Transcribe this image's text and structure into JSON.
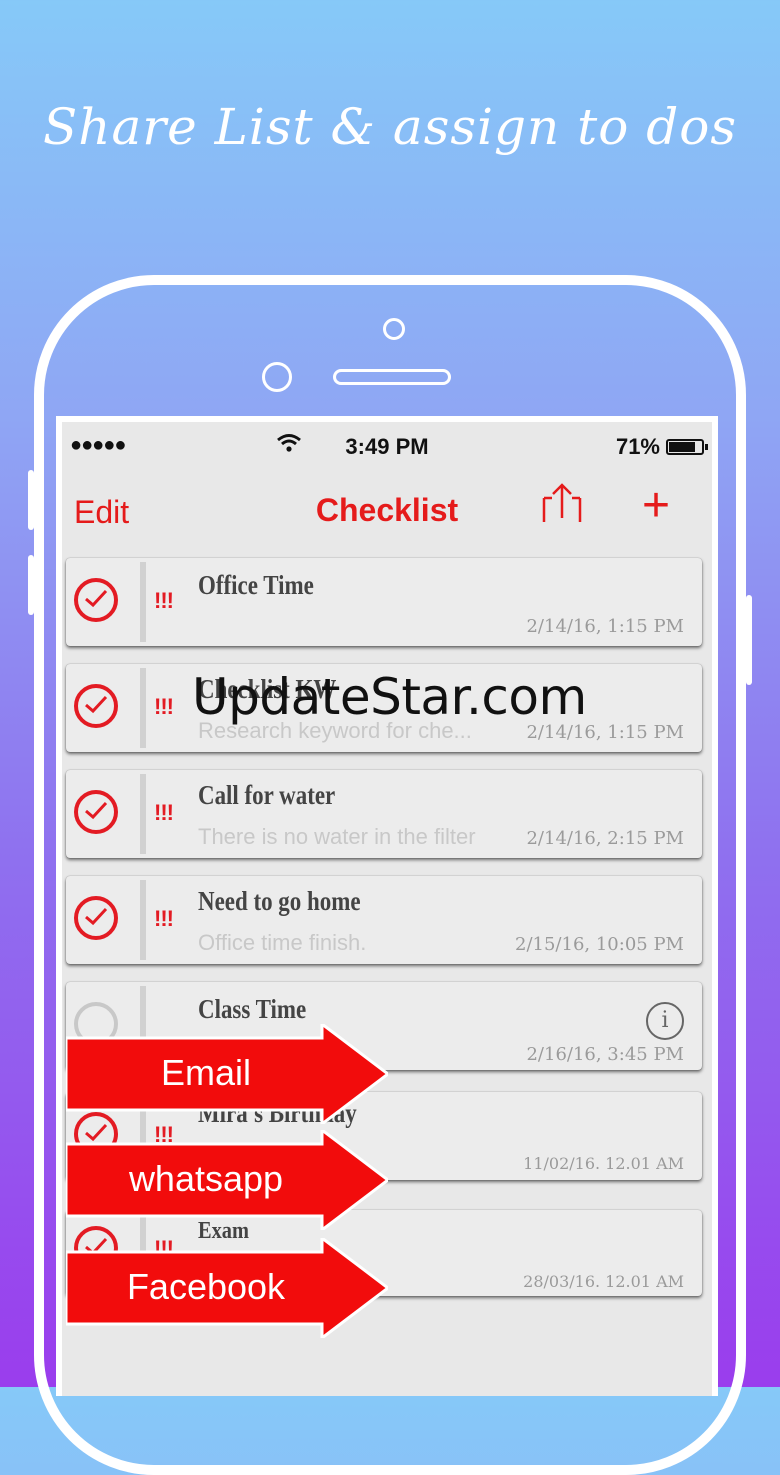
{
  "headline": "Share List  &  assign to dos",
  "status_bar": {
    "signal": "●●●●●",
    "time": "3:49 PM",
    "battery": "71%"
  },
  "nav": {
    "edit": "Edit",
    "title": "Checklist",
    "add": "+"
  },
  "items": [
    {
      "title": "Office Time",
      "subtitle": "",
      "priority": "!!!",
      "date": "2/14/16, 1:15 PM",
      "checked": true
    },
    {
      "title": "Checklist KW",
      "subtitle": "Research keyword for che...",
      "priority": "!!!",
      "date": "2/14/16, 1:15 PM",
      "checked": true
    },
    {
      "title": "Call for water",
      "subtitle": "There is no water in the filter",
      "priority": "!!!",
      "date": "2/14/16, 2:15 PM",
      "checked": true
    },
    {
      "title": "Need to go home",
      "subtitle": "Office time finish.",
      "priority": "!!!",
      "date": "2/15/16, 10:05 PM",
      "checked": true
    },
    {
      "title": "Class Time",
      "subtitle": "",
      "priority": "",
      "date": "2/16/16, 3:45 PM",
      "checked": false
    },
    {
      "title": "Mira's Birthday",
      "subtitle": "",
      "priority": "!!!",
      "date": "11/02/16. 12.01 AM",
      "checked": true
    },
    {
      "title": "Exam",
      "subtitle": "",
      "priority": "!!!",
      "date": "28/03/16. 12.01 AM",
      "checked": true
    }
  ],
  "share_options": [
    "Email",
    "whatsapp",
    "Facebook"
  ],
  "watermark": "UpdateStar.com",
  "colors": {
    "accent": "#e51b1b",
    "arrow": "#f20c0c"
  }
}
